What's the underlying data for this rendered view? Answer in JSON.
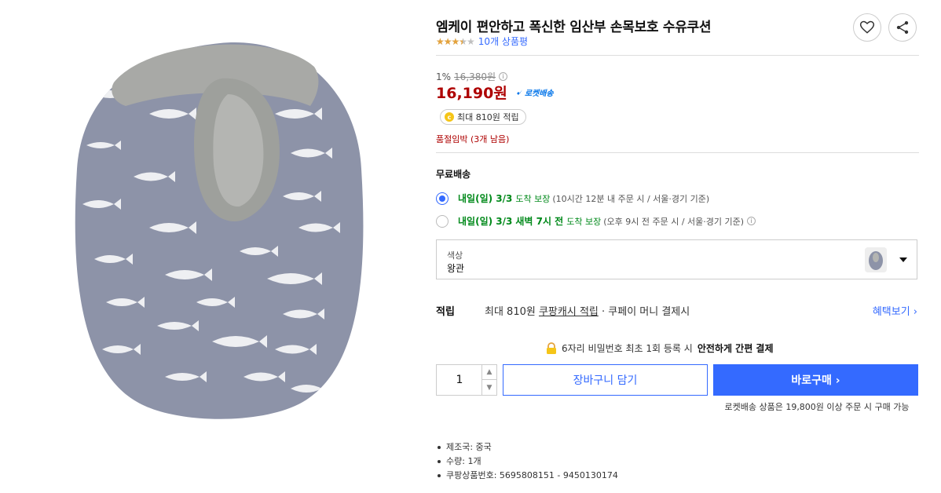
{
  "product": {
    "title": "엠케이 편안하고 폭신한 임산부 손목보호 수유쿠션",
    "rating": 3.5,
    "rating_max": 5,
    "review_count": "10개 상품평",
    "image_alt": "nursing cushion"
  },
  "actions": {
    "wishlist_icon": "heart-icon",
    "share_icon": "share-icon"
  },
  "price": {
    "discount_rate": "1%",
    "original_price": "16,380원",
    "sale_price": "16,190원",
    "rocket_label": "로켓배송",
    "cash_reward": "최대 810원 적립",
    "stock_status": "품절임박 (3개 남음)"
  },
  "shipping": {
    "title": "무료배송",
    "options": [
      {
        "highlight": "내일(일) 3/3",
        "highlight2": "",
        "suffix": "도착 보장",
        "detail": "(10시간 12분 내 주문 시 / 서울·경기 기준)",
        "selected": true
      },
      {
        "highlight": "내일(일) 3/3",
        "highlight2": "새벽 7시 전",
        "suffix": "도착 보장",
        "detail": "(오후 9시 전 주문 시 / 서울·경기 기준)",
        "selected": false
      }
    ]
  },
  "option": {
    "label": "색상",
    "value": "왕관"
  },
  "reward": {
    "label": "적립",
    "text_prefix": "최대 810원 ",
    "text_link": "쿠팡캐시 적립",
    "text_suffix": " · 쿠페이 머니 결제시",
    "benefit_link": "혜택보기 ›"
  },
  "secure": {
    "text": "6자리 비밀번호 최초 1회 등록 시",
    "bold": "안전하게 간편 결제"
  },
  "purchase": {
    "quantity": "1",
    "qty_up": "▲",
    "qty_down": "▼",
    "cart_label": "장바구니 담기",
    "buy_label": "바로구매 ›",
    "rocket_note": "로켓배송 상품은 19,800원 이상 주문 시 구매 가능"
  },
  "specs": [
    "제조국: 중국",
    "수량: 1개",
    "쿠팡상품번호: 5695808151 - 9450130174"
  ],
  "colors": {
    "accent": "#346aff",
    "price_red": "#ae0000",
    "ship_green": "#00891a",
    "cushion_body": "#8d93a8",
    "cushion_top": "#a8a9a6"
  }
}
